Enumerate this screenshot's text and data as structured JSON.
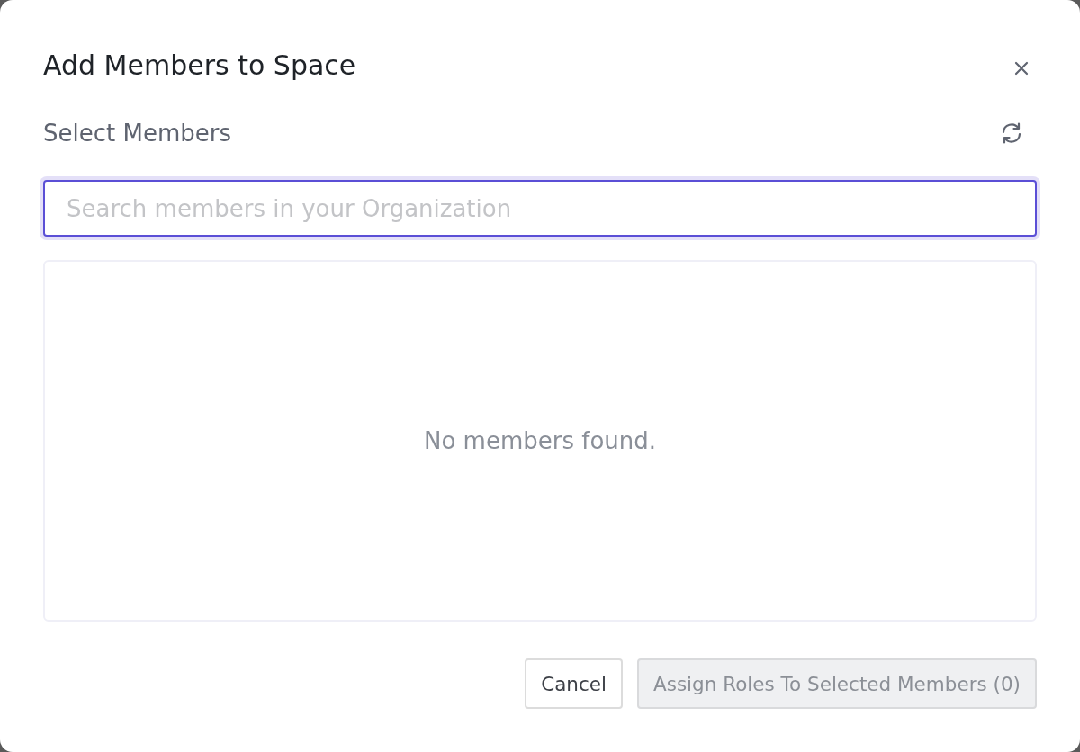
{
  "dialog": {
    "title": "Add Members to Space",
    "section_label": "Select Members",
    "search": {
      "placeholder": "Search members in your Organization",
      "focused": true
    },
    "results": {
      "empty_message": "No members found."
    },
    "buttons": [
      {
        "label": "Cancel",
        "kind": "secondary",
        "disabled": false
      },
      {
        "label": "Assign Roles To Selected Members (0)",
        "kind": "primary",
        "disabled": true
      }
    ]
  }
}
